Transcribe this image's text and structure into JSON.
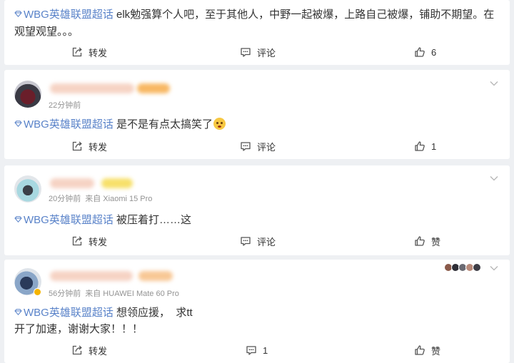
{
  "topic_tag": "WBG英雄联盟超话",
  "actions": {
    "repost": "转发",
    "comment": "评论",
    "like": "赞"
  },
  "colors": {
    "link": "#5a83c9",
    "meta": "#939393",
    "background": "#eef0f3"
  },
  "posts": [
    {
      "text": " elk勉强算个人吧，至于其他人，中野一起被爆，上路自己被爆，铺助不期望。在",
      "text2": "观望观望。。。",
      "repost": "转发",
      "comment": "评论",
      "like": "6"
    },
    {
      "time": "22分钟前",
      "text": " 是不是有点太搞笑了",
      "emoji": "thinking-face-emoji",
      "repost": "转发",
      "comment": "评论",
      "like": "1"
    },
    {
      "time": "20分钟前",
      "source": "来自 Xiaomi 15 Pro",
      "text": " 被压着打……这",
      "repost": "转发",
      "comment": "评论",
      "like": "赞"
    },
    {
      "time": "56分钟前",
      "source": "来自 HUAWEI Mate 60 Pro",
      "text": " 想领应援，  求tt",
      "text2": "开了加速，谢谢大家！！！",
      "repost": "转发",
      "comment": "1",
      "like": "赞"
    }
  ]
}
